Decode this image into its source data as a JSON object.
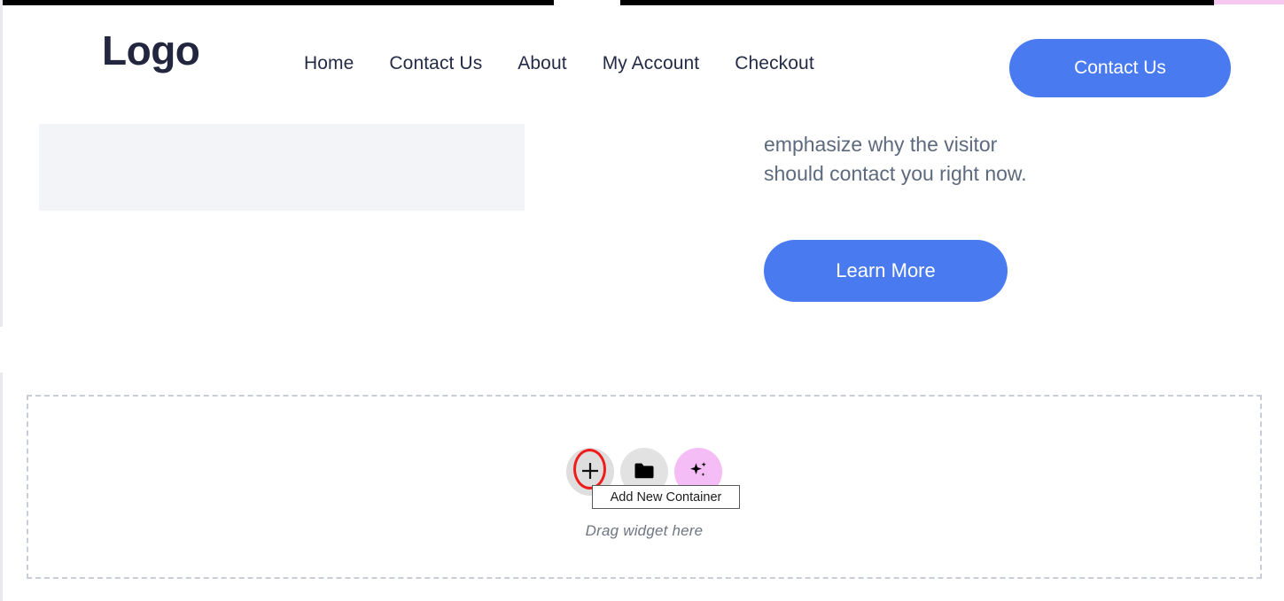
{
  "editor": {
    "collapse_handle_icon": "chevron-left-icon",
    "top_strip_pink_color": "#f6c7f0"
  },
  "site": {
    "header": {
      "logo_text": "Logo",
      "nav_items": [
        {
          "label": "Home"
        },
        {
          "label": "Contact Us"
        },
        {
          "label": "About"
        },
        {
          "label": "My Account"
        },
        {
          "label": "Checkout"
        }
      ],
      "cta_label": "Contact Us",
      "cta_color": "#4a7af0",
      "logo_color": "#22263f"
    },
    "hero": {
      "paragraph_line_1": "emphasize why the visitor",
      "paragraph_line_2": "should contact you right now.",
      "paragraph_color": "#5d6a7e",
      "cta_label": "Learn More",
      "cta_color": "#4a7af0",
      "placeholder_color": "#f2f4f8"
    }
  },
  "drop_zone": {
    "drag_label": "Drag widget here",
    "border_color": "#c9cdd6",
    "actions": [
      {
        "name": "add-new-container",
        "icon": "plus-icon",
        "bg": "#dedede"
      },
      {
        "name": "add-template",
        "icon": "folder-icon",
        "bg": "#e2e2e2"
      },
      {
        "name": "ai-builder",
        "icon": "sparkle-icon",
        "bg": "#f4bdf5"
      }
    ],
    "tooltip": {
      "text": "Add New Container"
    }
  },
  "annotation": {
    "highlight_color": "#f01c1c",
    "target": "add-new-container-button"
  }
}
